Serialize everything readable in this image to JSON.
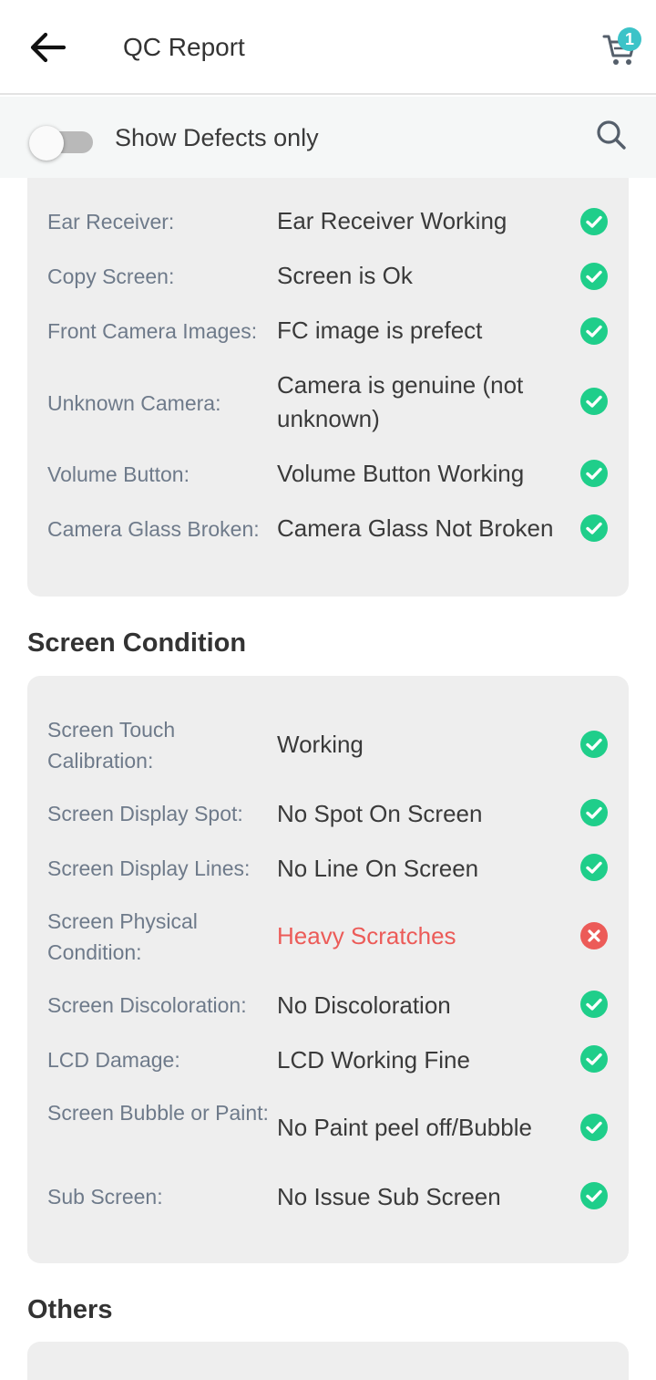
{
  "header": {
    "title": "QC Report",
    "cart_count": "1"
  },
  "filter": {
    "label": "Show Defects only",
    "enabled": false
  },
  "colors": {
    "ok": "#1fce8a",
    "defect": "#ec5b58",
    "accent": "#3cc3c8"
  },
  "sections": {
    "top": {
      "rows": [
        {
          "label": "Ear Receiver:",
          "value": "Ear Receiver Working",
          "status": "ok"
        },
        {
          "label": "Copy Screen:",
          "value": "Screen is Ok",
          "status": "ok"
        },
        {
          "label": "Front Camera Images:",
          "value": "FC image is prefect",
          "status": "ok"
        },
        {
          "label": "Unknown Camera:",
          "value": "Camera is genuine (not unknown)",
          "status": "ok"
        },
        {
          "label": "Volume Button:",
          "value": "Volume Button Working",
          "status": "ok"
        },
        {
          "label": "Camera Glass Broken:",
          "value": "Camera Glass Not Broken",
          "status": "ok"
        }
      ]
    },
    "screen": {
      "title": "Screen Condition",
      "rows": [
        {
          "label": "Screen Touch Calibration:",
          "value": "Working",
          "status": "ok"
        },
        {
          "label": "Screen Display Spot:",
          "value": "No Spot On Screen",
          "status": "ok"
        },
        {
          "label": "Screen Display Lines:",
          "value": "No Line On Screen",
          "status": "ok"
        },
        {
          "label": "Screen Physical Condition:",
          "value": "Heavy Scratches",
          "status": "defect"
        },
        {
          "label": "Screen Discoloration:",
          "value": "No Discoloration",
          "status": "ok"
        },
        {
          "label": "LCD Damage:",
          "value": "LCD Working Fine",
          "status": "ok"
        },
        {
          "label": "Screen Bubble or Paint:",
          "value": "No Paint peel off/Bubble",
          "status": "ok"
        },
        {
          "label": "Sub Screen:",
          "value": "No Issue Sub Screen",
          "status": "ok"
        }
      ]
    },
    "others": {
      "title": "Others"
    }
  }
}
